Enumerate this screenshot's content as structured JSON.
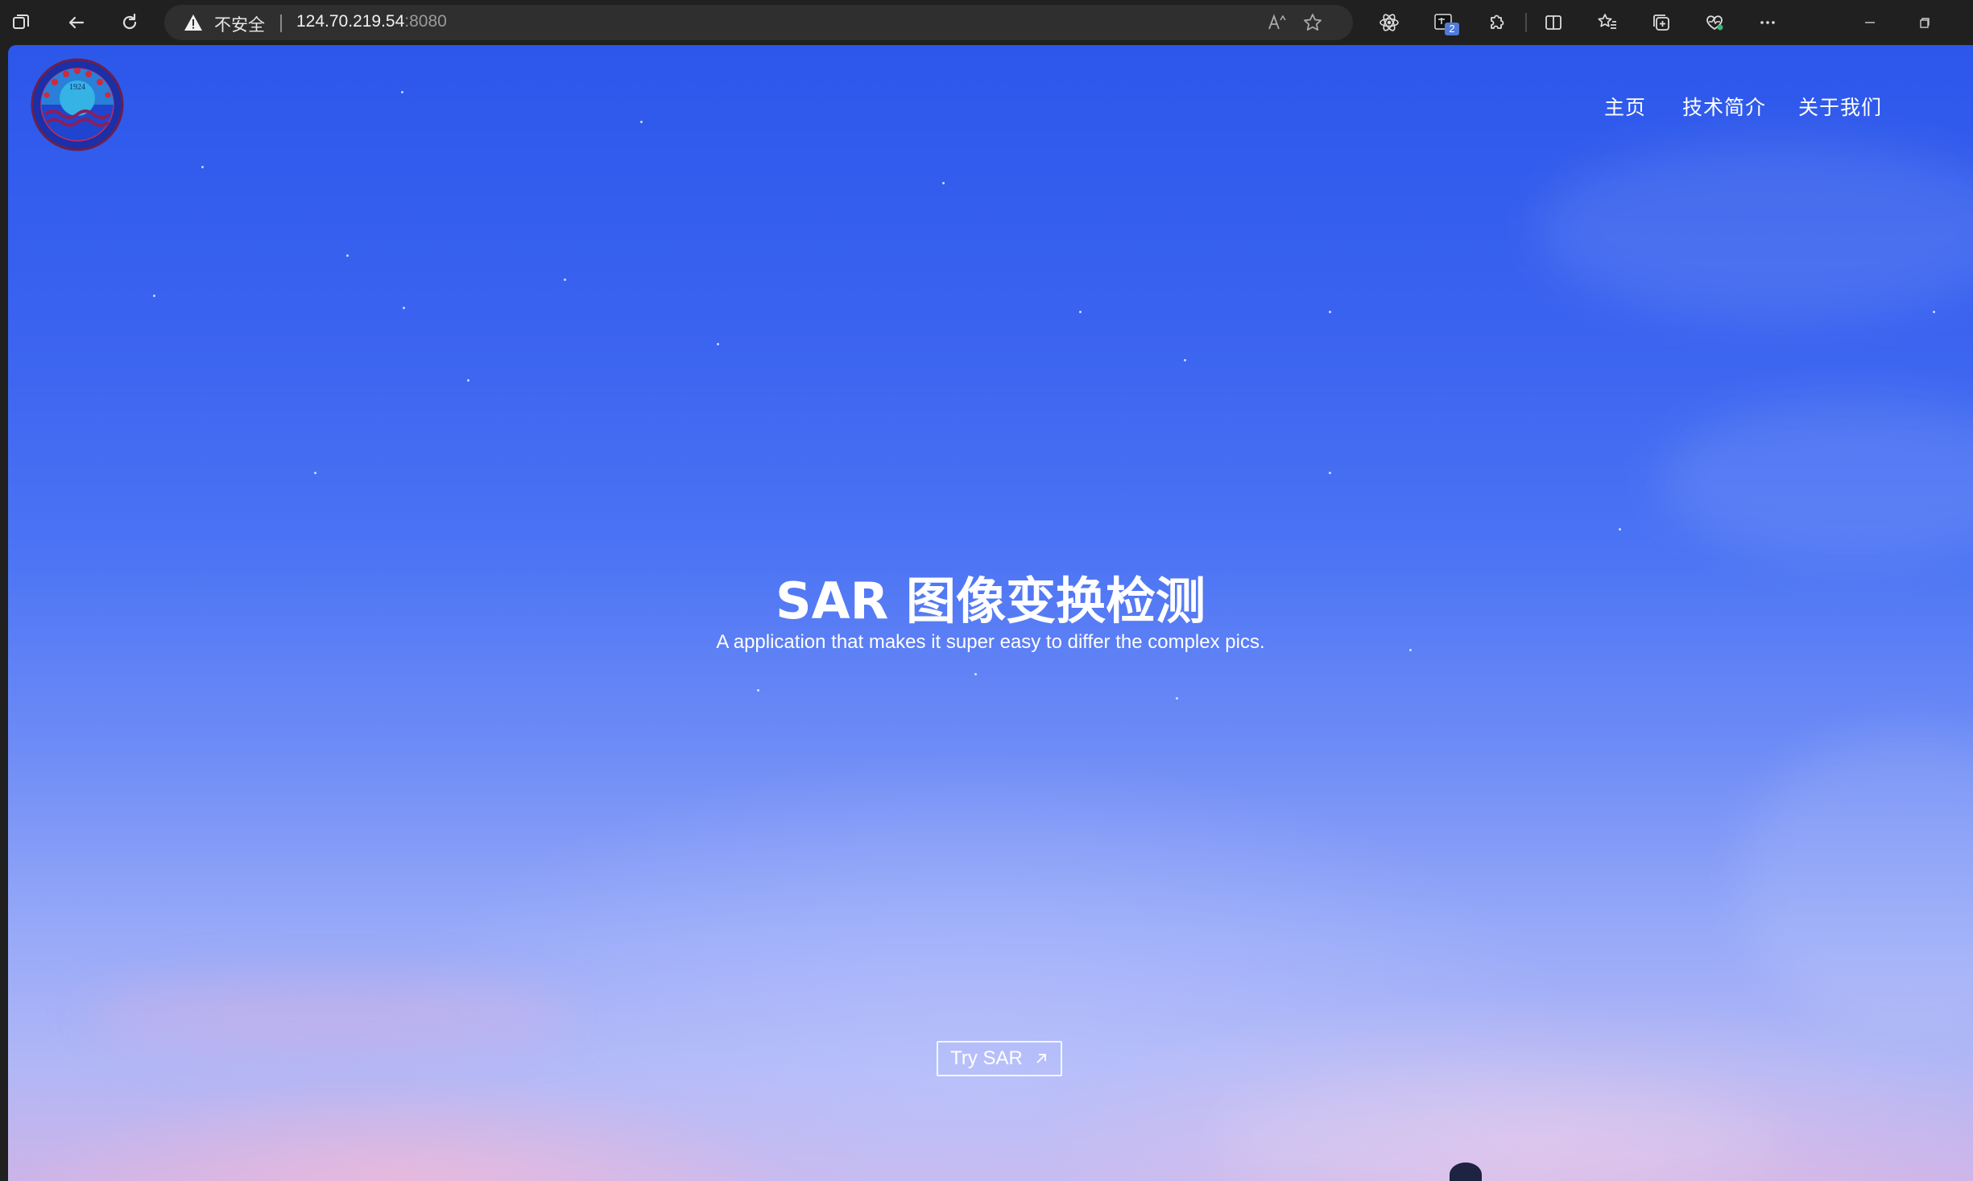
{
  "browser": {
    "security_label": "不安全",
    "url_host": "124.70.219.54",
    "url_port": ":8080",
    "extension_badge": "2",
    "icons": [
      "tab-actions-icon",
      "back-icon",
      "refresh-icon",
      "warning-icon",
      "read-aloud-icon",
      "favorite-star-icon",
      "extension-react-icon",
      "extension-translate-icon",
      "extensions-icon",
      "split-screen-icon",
      "favorites-icon",
      "collections-icon",
      "browser-essentials-icon",
      "more-icon",
      "minimize-icon",
      "restore-icon"
    ]
  },
  "site": {
    "logo_year": "1924",
    "nav": {
      "home": "主页",
      "tech": "技术简介",
      "about": "关于我们"
    },
    "hero": {
      "title": "SAR 图像变换检测",
      "subtitle": "A application that makes it super easy to differ the complex pics.",
      "cta": "Try SAR"
    }
  },
  "colors": {
    "sky_top": "#2c57ea",
    "sky_bottom": "#cdb4e8",
    "chrome_bg": "#202020"
  }
}
